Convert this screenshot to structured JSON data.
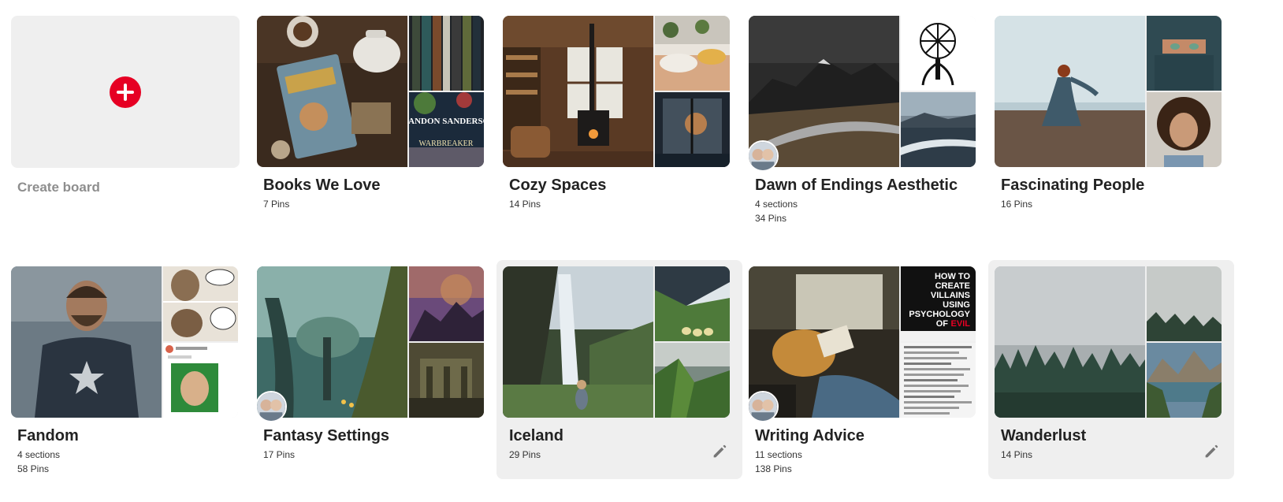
{
  "create_board": {
    "label": "Create board"
  },
  "boards": [
    {
      "title": "Books We Love",
      "meta1": "7 Pins",
      "meta2": ""
    },
    {
      "title": "Cozy Spaces",
      "meta1": "14 Pins",
      "meta2": ""
    },
    {
      "title": "Dawn of Endings Aesthetic",
      "meta1": "4 sections",
      "meta2": "34 Pins"
    },
    {
      "title": "Fascinating People",
      "meta1": "16 Pins",
      "meta2": ""
    },
    {
      "title": "Fandom",
      "meta1": "4 sections",
      "meta2": "58 Pins"
    },
    {
      "title": "Fantasy Settings",
      "meta1": "17 Pins",
      "meta2": ""
    },
    {
      "title": "Iceland",
      "meta1": "29 Pins",
      "meta2": ""
    },
    {
      "title": "Writing Advice",
      "meta1": "11 sections",
      "meta2": "138 Pins"
    },
    {
      "title": "Wanderlust",
      "meta1": "14 Pins",
      "meta2": ""
    }
  ],
  "cover_texts": {
    "warbreaker_author": "BRANDON SANDERSON",
    "warbreaker_title": "WARBREAKER",
    "villains_line1": "HOW TO",
    "villains_line2": "CREATE",
    "villains_line3": "VILLAINS",
    "villains_line4": "USING",
    "villains_line5": "PSYCHOLOGY",
    "villains_line6": "OF",
    "villains_line7": "EVIL"
  },
  "colors": {
    "accent": "#e60023",
    "tile_bg": "#efefef",
    "title_text": "#222222",
    "muted_text": "#8e8e8e"
  },
  "icons": {
    "create": "plus-circle-icon",
    "edit": "pencil-icon",
    "collaborator": "avatar"
  }
}
